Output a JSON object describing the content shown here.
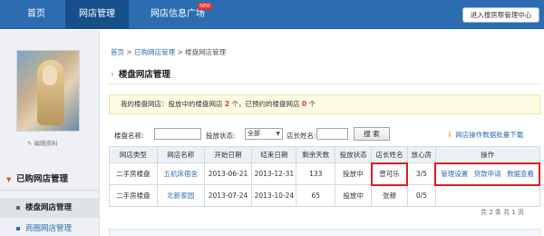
{
  "nav": {
    "items": [
      "首页",
      "网店管理",
      "网店信息广场"
    ],
    "new_badge": "NEW",
    "portal_button": "进入搜房帮管理中心"
  },
  "sidebar": {
    "edit_profile": "编辑资料",
    "section_title": "已购网店管理",
    "items": [
      "楼盘网店管理",
      "商圈网店管理"
    ]
  },
  "breadcrumb": {
    "home": "首页",
    "sep": ">",
    "bought": "已购网店管理",
    "current": "楼盘网店管理"
  },
  "page_title": "楼盘网店管理",
  "notice": {
    "prefix": "我的楼盘网店：投放中的楼盘网店",
    "count_running": "2",
    "middle": "个，已预约的楼盘网店",
    "count_reserved": "0",
    "suffix": "个"
  },
  "filter": {
    "building_label": "楼盘名称:",
    "building_value": "",
    "status_label": "投放状态:",
    "status_selected": "全部",
    "manager_label": "店长姓名:",
    "manager_value": "",
    "search_button": "搜 索",
    "download_link": "网店操作数据批量下载"
  },
  "table": {
    "headers": [
      "网店类型",
      "网店名称",
      "开始日期",
      "结束日期",
      "剩余天数",
      "投放状态",
      "店长姓名",
      "放心房",
      "操作"
    ],
    "rows": [
      {
        "type": "二手房楼盘",
        "name": "五机床宿舍",
        "start": "2013-06-21",
        "end": "2013-12-31",
        "days": "133",
        "status": "投放中",
        "manager": "曾可乐",
        "fangxin": "3/5",
        "ops": [
          "管理设置",
          "贷款申请",
          "数据查看"
        ]
      },
      {
        "type": "二手房楼盘",
        "name": "北新家园",
        "start": "2013-07-24",
        "end": "2013-10-24",
        "days": "65",
        "status": "投放中",
        "manager": "张穆",
        "fangxin": "0/5",
        "ops": []
      }
    ]
  },
  "pager": "共 2 条 共 1 页",
  "colors": {
    "nav": "#2b6db0",
    "highlight": "#e01c1c",
    "link": "#2b6db0"
  }
}
